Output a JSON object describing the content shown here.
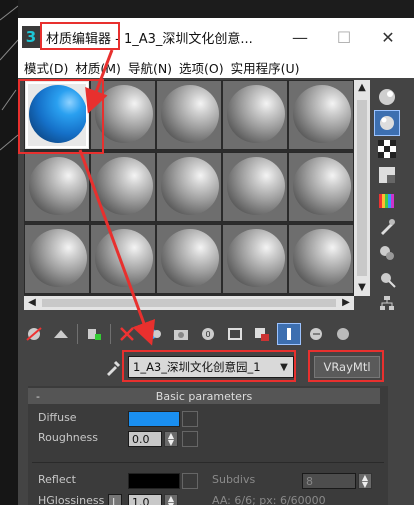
{
  "window": {
    "title": "材质编辑器 - 1_A3_深圳文化创意...",
    "app_icon": "3",
    "controls": {
      "minimize": "—",
      "maximize": "☐",
      "close": "✕"
    }
  },
  "menu": [
    "模式(D)",
    "材质(M)",
    "导航(N)",
    "选项(O)",
    "实用程序(U)"
  ],
  "sample_slots": {
    "rows": 3,
    "cols": 5,
    "active_index": 0,
    "active_color": "#1f7fdc"
  },
  "material": {
    "name": "1_A3_深圳文化创意园_1",
    "type": "VRayMtl"
  },
  "basic_parameters": {
    "title": "Basic parameters",
    "collapse": "-",
    "diffuse_label": "Diffuse",
    "diffuse_color": "#1a8ff0",
    "roughness_label": "Roughness",
    "roughness_value": "0.0",
    "reflect_label": "Reflect",
    "reflect_color": "#000000",
    "subdivs_label": "Subdivs",
    "subdivs_value": "8",
    "hglossiness_label": "HGlossiness",
    "hglossiness_lock": "L",
    "hglossiness_value": "1.0",
    "aa_text": "AA: 6/6; px: 6/60000"
  },
  "annotation_color": "#e8302e"
}
